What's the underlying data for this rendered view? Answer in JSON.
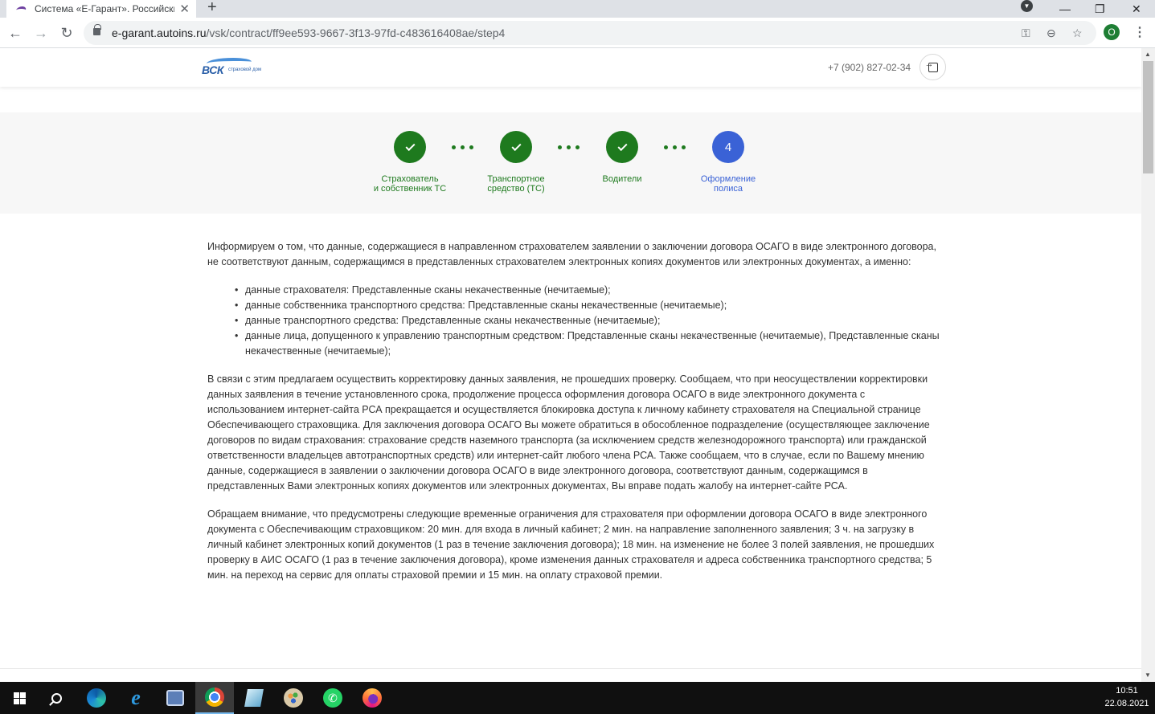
{
  "browser": {
    "tab_title": "Система «Е-Гарант». Российски",
    "url_host": "e-garant.autoins.ru",
    "url_path": "/vsk/contract/ff9ee593-9667-3f13-97fd-c483616408ae/step4"
  },
  "header": {
    "logo_text": "ВСК",
    "logo_sub": "страховой дом",
    "phone": "+7 (902) 827-02-34"
  },
  "steps": [
    {
      "label": "Страхователь\nи собственник ТС",
      "state": "done"
    },
    {
      "label": "Транспортное\nсредство (ТС)",
      "state": "done"
    },
    {
      "label": "Водители",
      "state": "done"
    },
    {
      "label": "Оформление\nполиса",
      "state": "active",
      "number": "4"
    }
  ],
  "content": {
    "intro": "Информируем о том, что данные, содержащиеся в направленном страхователем заявлении о заключении договора ОСАГО в виде электронного договора, не соответствуют данным, содержащимся в представленных страхователем электронных копиях документов или электронных документах, а именно:",
    "items": [
      "данные страхователя: Представленные сканы некачественные (нечитаемые);",
      "данные собственника транспортного средства: Представленные сканы некачественные (нечитаемые);",
      "данные транспортного средства: Представленные сканы некачественные (нечитаемые);",
      "данные лица, допущенного к управлению транспортным средством: Представленные сканы некачественные (нечитаемые), Представленные сканы некачественные (нечитаемые);"
    ],
    "para2": "В связи с этим предлагаем осуществить корректировку данных заявления, не прошедших проверку. Сообщаем, что при неосуществлении корректировки данных заявления в течение установленного срока, продолжение процесса оформления договора ОСАГО в виде электронного документа с использованием интернет-сайта РСА прекращается и осуществляется блокировка доступа к личному кабинету страхователя на Специальной странице Обеспечивающего страховщика. Для заключения договора ОСАГО Вы можете обратиться в обособленное подразделение (осуществляющее заключение договоров по видам страхования: страхование средств наземного транспорта (за исключением средств железнодорожного транспорта) или гражданской ответственности владельцев автотранспортных средств) или интернет-сайт любого члена РСА. Также сообщаем, что в случае, если по Вашему мнению данные, содержащиеся в заявлении о заключении договора ОСАГО в виде электронного договора, соответствуют данным, содержащимся в представленных Вами электронных копиях документов или электронных документах, Вы вправе подать жалобу на интернет-сайте РСА.",
    "para3": "Обращаем внимание, что предусмотрены следующие временные ограничения для страхователя при оформлении договора ОСАГО в виде электронного документа с Обеспечивающим страховщиком: 20 мин. для входа в личный кабинет; 2 мин. на направление заполненного заявления; 3 ч. на загрузку в личный кабинет электронных копий документов (1 раз в течение заключения договора); 18 мин. на изменение не более 3 полей заявления, не прошедших проверку в АИС ОСАГО (1 раз в течение заключения договора), кроме изменения данных страхователя и адреса собственника транспортного средства; 5 мин. на переход на сервис для оплаты страховой премии и 15 мин. на оплату страховой премии."
  },
  "taskbar": {
    "time": "10:51",
    "date": "22.08.2021"
  }
}
